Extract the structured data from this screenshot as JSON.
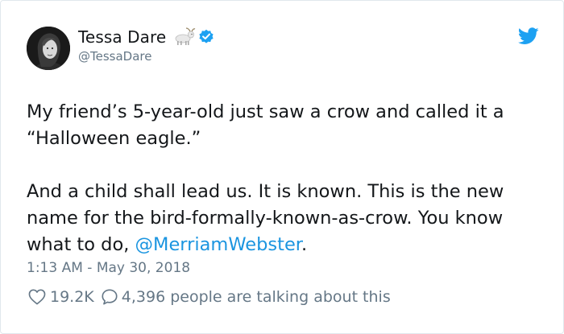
{
  "author": {
    "name": "Tessa Dare",
    "handle": "@TessaDare",
    "name_emoji": "goat-emoji",
    "verified_icon": "verified-badge-icon",
    "avatar": "author-avatar-photo"
  },
  "brand": {
    "icon": "twitter-bird-icon",
    "accent_color": "#1da1f2",
    "link_color": "#1b95e0"
  },
  "tweet": {
    "para1": "My friend’s 5-year-old just saw a crow and called it a “Halloween eagle.”",
    "para2_text": "And a child shall lead us. It is known. This is the new name for the bird-formally-known-as-crow. You know what to do, ",
    "mention": "@MerriamWebster",
    "para2_end": "."
  },
  "timestamp": "1:13 AM - May 30, 2018",
  "engagement": {
    "likes": "19.2K",
    "like_icon": "heart-icon",
    "conversation_icon": "speech-bubble-icon",
    "conversation_text": "4,396 people are talking about this"
  }
}
